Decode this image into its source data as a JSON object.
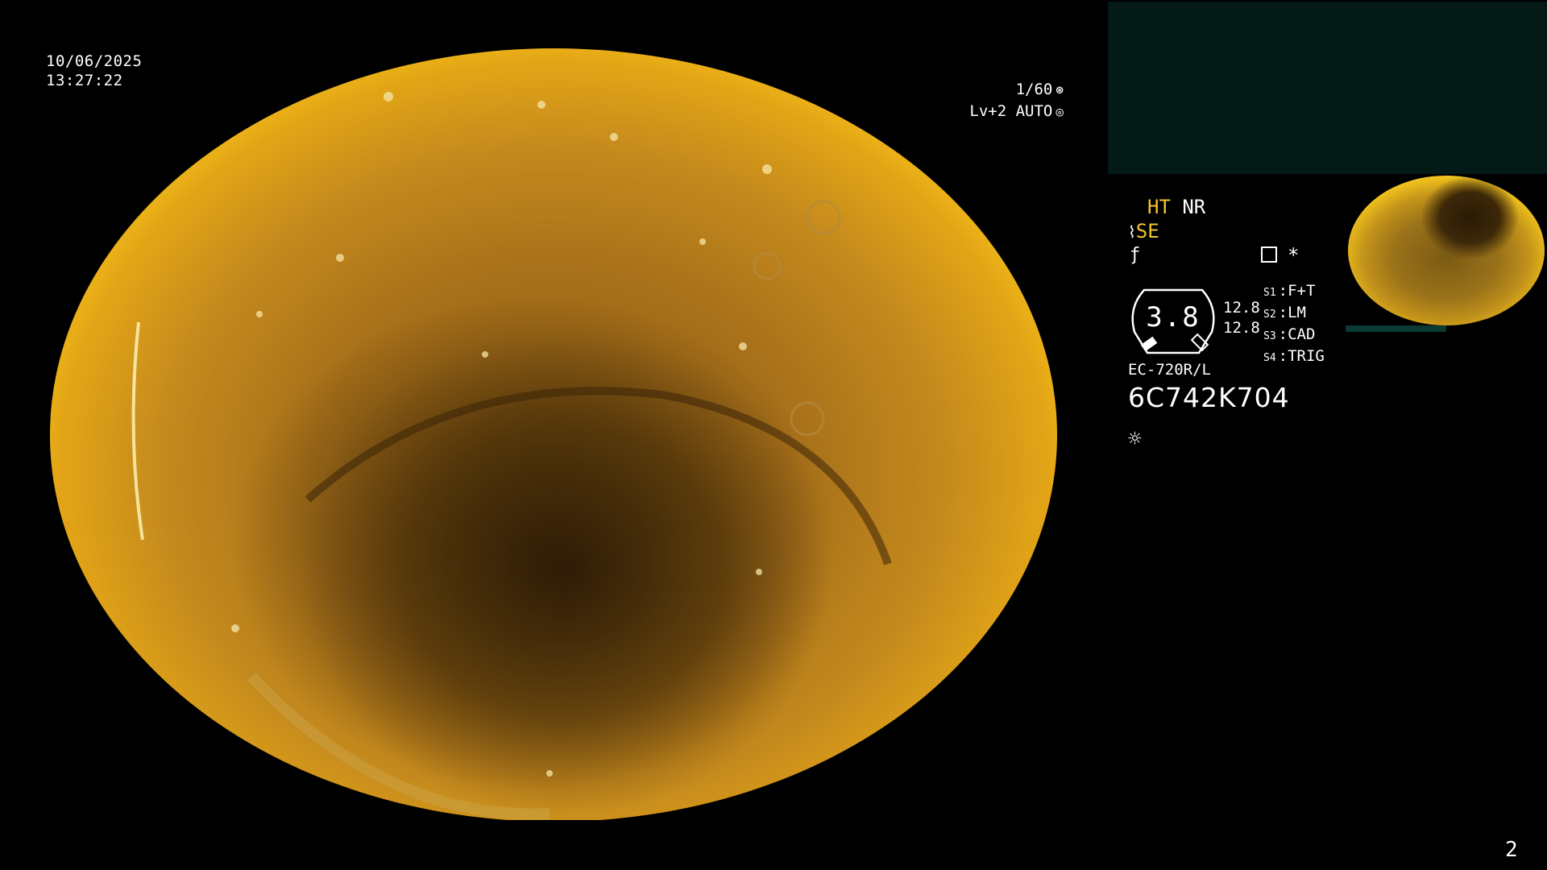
{
  "overlay": {
    "date": "10/06/2025",
    "time": "13:27:22",
    "shutter": "1/60",
    "level": "Lv+2",
    "iris": "AUTO"
  },
  "modes": {
    "ht": "HT",
    "nr": "NR",
    "se": "SE"
  },
  "gauge": {
    "value": "3.8",
    "value_top": "12.8",
    "value_bottom": "12.8"
  },
  "switches": [
    {
      "key": "S1",
      "label": "F+T"
    },
    {
      "key": "S2",
      "label": "LM"
    },
    {
      "key": "S3",
      "label": "CAD"
    },
    {
      "key": "S4",
      "label": "TRIG"
    }
  ],
  "scope": {
    "model": "EC-720R/L",
    "serial": "6C742K704"
  },
  "page": "2",
  "icons": {
    "shutter_icon": "aperture-icon",
    "iris_icon": "iris-icon",
    "light_icon": "sun-icon",
    "record_icon": "record-icon",
    "star_icon": "asterisk-icon"
  }
}
